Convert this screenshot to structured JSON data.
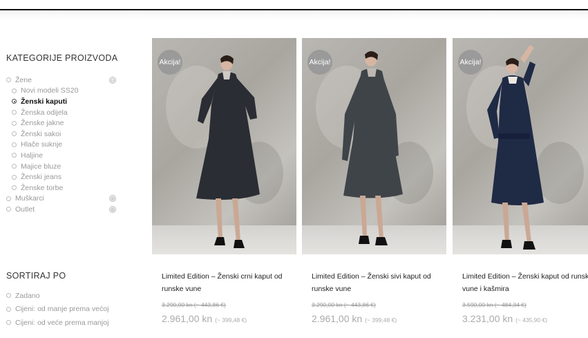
{
  "categories": {
    "title": "KATEGORIJE PROIZVODA",
    "items": [
      {
        "label": "Žene",
        "level": 0,
        "active": false,
        "toggle": "⊖"
      },
      {
        "label": "Novi modeli SS20",
        "level": 1,
        "active": false
      },
      {
        "label": "Ženski kaputi",
        "level": 1,
        "active": true
      },
      {
        "label": "Ženska odijela",
        "level": 1,
        "active": false
      },
      {
        "label": "Ženske jakne",
        "level": 1,
        "active": false
      },
      {
        "label": "Ženski sakoi",
        "level": 1,
        "active": false
      },
      {
        "label": "Hlače suknje",
        "level": 1,
        "active": false
      },
      {
        "label": "Haljine",
        "level": 1,
        "active": false
      },
      {
        "label": "Majice bluze",
        "level": 1,
        "active": false
      },
      {
        "label": "Ženski jeans",
        "level": 1,
        "active": false
      },
      {
        "label": "Ženske torbe",
        "level": 1,
        "active": false
      },
      {
        "label": "Muškarci",
        "level": 0,
        "active": false,
        "toggle": "⊕"
      },
      {
        "label": "Outlet",
        "level": 0,
        "active": false,
        "toggle": "⊕"
      }
    ]
  },
  "sort": {
    "title": "SORTIRAJ PO",
    "items": [
      "Zadano",
      "Cijeni: od manje prema većoj",
      "Cijeni: od veće prema manjoj"
    ]
  },
  "products": [
    {
      "badge": "Akcija!",
      "name": "Limited Edition – Ženski crni kaput od runske vune",
      "old_price": "3.290,00 kn (~ 443,86 €)",
      "new_price": "2.961,00 kn",
      "new_price_eur": "(~ 399,48 €)",
      "coat_color": "#2a2d33"
    },
    {
      "badge": "Akcija!",
      "name": "Limited Edition – Ženski sivi kaput od runske vune",
      "old_price": "3.290,00 kn (~ 443,86 €)",
      "new_price": "2.961,00 kn",
      "new_price_eur": "(~ 399,48 €)",
      "coat_color": "#3f4449"
    },
    {
      "badge": "Akcija!",
      "name": "Limited Edition – Ženski kaput od runske vune i kašmira",
      "old_price": "3.590,00 kn (~ 484,34 €)",
      "new_price": "3.231,00 kn",
      "new_price_eur": "(~ 435,90 €)",
      "coat_color": "#1f2a45"
    }
  ],
  "colors": {
    "badge": "#9a9a9a",
    "accent_text": "#222222",
    "muted": "#999999"
  }
}
